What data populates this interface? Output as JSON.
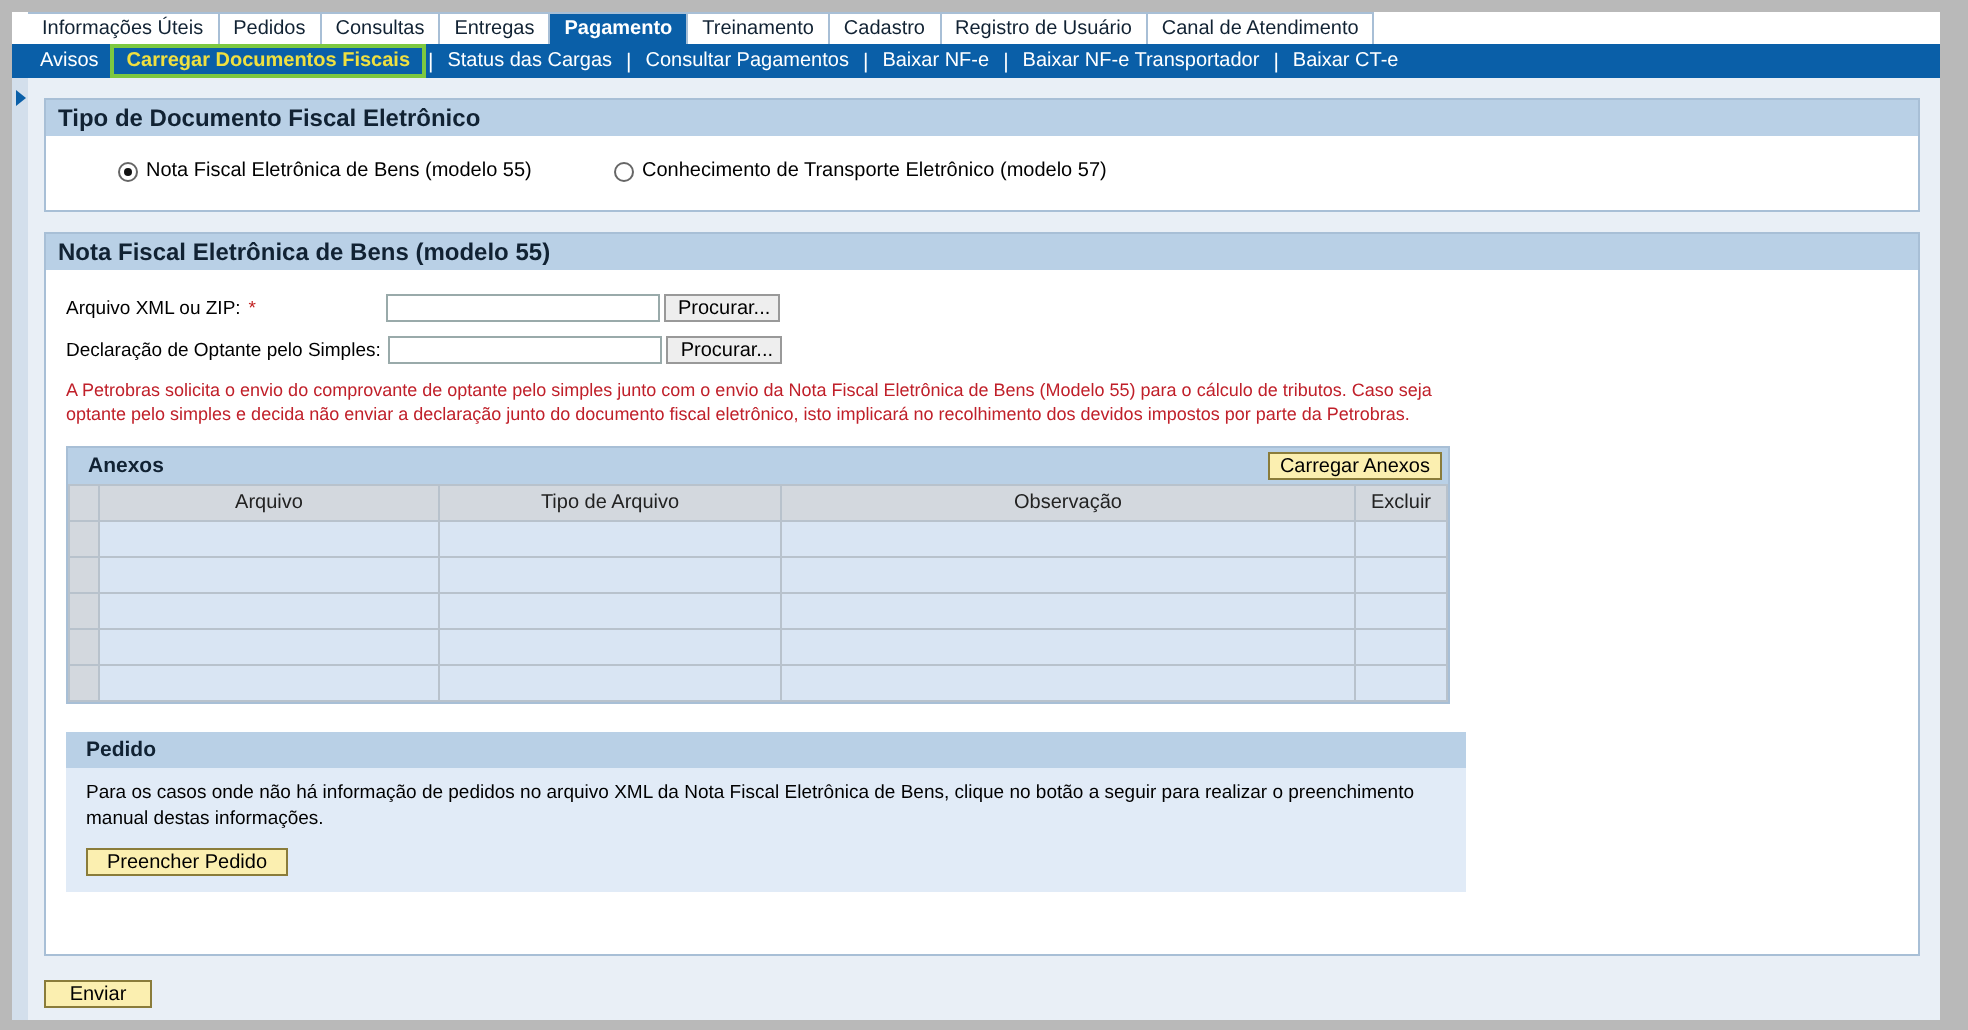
{
  "top_tabs": [
    {
      "label": "Informações Úteis",
      "selected": false
    },
    {
      "label": "Pedidos",
      "selected": false
    },
    {
      "label": "Consultas",
      "selected": false
    },
    {
      "label": "Entregas",
      "selected": false
    },
    {
      "label": "Pagamento",
      "selected": true
    },
    {
      "label": "Treinamento",
      "selected": false
    },
    {
      "label": "Cadastro",
      "selected": false
    },
    {
      "label": "Registro de Usuário",
      "selected": false
    },
    {
      "label": "Canal de Atendimento",
      "selected": false
    }
  ],
  "sub_nav": [
    {
      "label": "Avisos",
      "selected": false
    },
    {
      "label": "Carregar Documentos Fiscais",
      "selected": true
    },
    {
      "label": "Status das Cargas",
      "selected": false
    },
    {
      "label": "Consultar Pagamentos",
      "selected": false
    },
    {
      "label": "Baixar NF-e",
      "selected": false
    },
    {
      "label": "Baixar NF-e Transportador",
      "selected": false
    },
    {
      "label": "Baixar CT-e",
      "selected": false
    }
  ],
  "sub_nav_separator": "|",
  "document_type": {
    "title": "Tipo de Documento Fiscal Eletrônico",
    "options": [
      {
        "label": "Nota Fiscal Eletrônica de Bens (modelo 55)",
        "selected": true
      },
      {
        "label": "Conhecimento de Transporte Eletrônico (modelo 57)",
        "selected": false
      }
    ]
  },
  "nfe_section": {
    "title": "Nota Fiscal Eletrônica de Bens (modelo 55)",
    "fields": [
      {
        "label": "Arquivo XML ou ZIP:",
        "required": true,
        "button": "Procurar..."
      },
      {
        "label": "Declaração de Optante pelo Simples:",
        "required": false,
        "button": "Procurar..."
      }
    ],
    "required_mark": "*",
    "notice": "A Petrobras solicita o envio do comprovante de optante pelo simples junto com o envio da Nota Fiscal Eletrônica de Bens (Modelo 55) para o cálculo de tributos. Caso seja optante pelo simples e decida não enviar a declaração junto do documento fiscal eletrônico, isto implicará no recolhimento dos devidos impostos por parte da Petrobras.",
    "attachments": {
      "title": "Anexos",
      "button": "Carregar Anexos",
      "columns": [
        "Arquivo",
        "Tipo de Arquivo",
        "Observação",
        "Excluir"
      ],
      "rows": [
        {},
        {},
        {},
        {},
        {}
      ]
    },
    "order": {
      "title": "Pedido",
      "text": "Para os casos onde não há informação de pedidos no arquivo XML da Nota Fiscal Eletrônica de Bens, clique no botão a seguir para realizar o preenchimento manual destas informações.",
      "button": "Preencher Pedido"
    }
  },
  "submit_button": "Enviar"
}
